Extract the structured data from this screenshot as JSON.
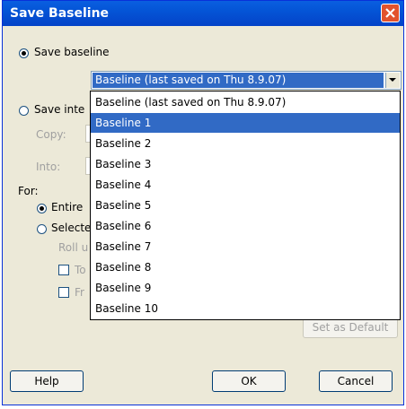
{
  "window": {
    "title": "Save Baseline"
  },
  "save_baseline": {
    "label": "Save baseline"
  },
  "baseline_select": {
    "selected": "Baseline (last saved on Thu 8.9.07)",
    "options": [
      "Baseline (last saved on Thu 8.9.07)",
      "Baseline 1",
      "Baseline 2",
      "Baseline 3",
      "Baseline 4",
      "Baseline 5",
      "Baseline 6",
      "Baseline 7",
      "Baseline 8",
      "Baseline 9",
      "Baseline 10"
    ],
    "highlighted_index": 1
  },
  "save_interim": {
    "label": "Save inte"
  },
  "copy": {
    "label": "Copy:"
  },
  "into": {
    "label": "Into:"
  },
  "for": {
    "label": "For:",
    "entire": "Entire",
    "selected": "Selecte",
    "rollup": "Roll u",
    "to_all": "To",
    "from": "Fr"
  },
  "buttons": {
    "set_default": "Set as Default",
    "help": "Help",
    "ok": "OK",
    "cancel": "Cancel"
  },
  "colors": {
    "title_bar": "#0454d6",
    "selection": "#316ac5",
    "dialog_bg": "#ece9d8"
  }
}
